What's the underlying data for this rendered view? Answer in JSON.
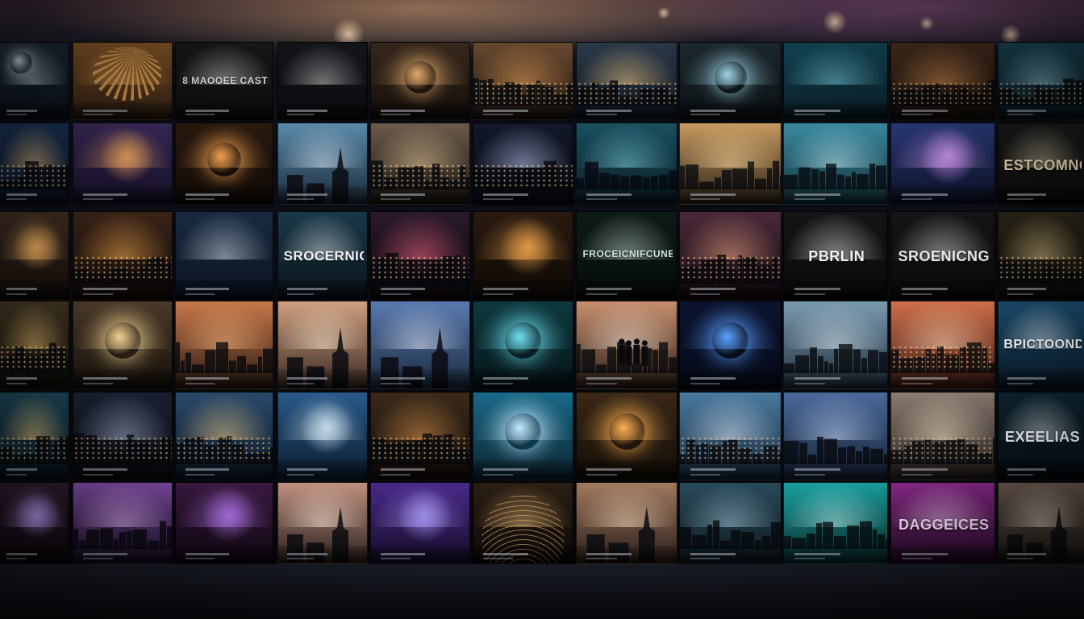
{
  "scene": {
    "description_colors": {
      "warm": "#e8a35a",
      "teal": "#2aa6b8",
      "purple": "#7a3fb0",
      "night": "#0e1422"
    }
  },
  "tiles": [
    {
      "theme": "moon",
      "palette": [
        "#1d2a3a",
        "#0c111a"
      ],
      "accent": "#cfd8e6",
      "caption": ""
    },
    {
      "theme": "rays",
      "palette": [
        "#8a5a2a",
        "#2a1a10"
      ],
      "accent": "#f4b15c",
      "caption": ""
    },
    {
      "theme": "title",
      "palette": [
        "#1a1a1a",
        "#0d0d0d"
      ],
      "accent": "#e6e6e6",
      "caption": "8 MAOOEE CAST"
    },
    {
      "theme": "title",
      "palette": [
        "#15161b",
        "#0b0b0f"
      ],
      "accent": "#c9c9c9",
      "caption": ""
    },
    {
      "theme": "orb",
      "palette": [
        "#3a2a1e",
        "#110c09"
      ],
      "accent": "#e0a86a",
      "caption": ""
    },
    {
      "theme": "city",
      "palette": [
        "#6a4a30",
        "#1a1410"
      ],
      "accent": "#f2a65a",
      "caption": ""
    },
    {
      "theme": "city",
      "palette": [
        "#2c3a4a",
        "#0e141c"
      ],
      "accent": "#ffd38c",
      "caption": ""
    },
    {
      "theme": "orb",
      "palette": [
        "#1e2a30",
        "#0a0f12"
      ],
      "accent": "#9fd4e8",
      "caption": ""
    },
    {
      "theme": "title",
      "palette": [
        "#134a5a",
        "#0a1a22"
      ],
      "accent": "#7ed6e8",
      "caption": ""
    },
    {
      "theme": "city",
      "palette": [
        "#4a3020",
        "#140e0a"
      ],
      "accent": "#f2a25a",
      "caption": ""
    },
    {
      "theme": "city",
      "palette": [
        "#1e4a5a",
        "#0a1820"
      ],
      "accent": "#9fe0ee",
      "caption": ""
    },
    {
      "theme": "city",
      "palette": [
        "#1a3050",
        "#0a1220"
      ],
      "accent": "#ffcf80",
      "caption": ""
    },
    {
      "theme": "galaxy",
      "palette": [
        "#3a2a5a",
        "#140e24"
      ],
      "accent": "#ffb060",
      "caption": ""
    },
    {
      "theme": "orb",
      "palette": [
        "#2a1a10",
        "#0e0906"
      ],
      "accent": "#f0a050",
      "caption": ""
    },
    {
      "theme": "spires",
      "palette": [
        "#5a8aaa",
        "#1a2a3a"
      ],
      "accent": "#e0eef8",
      "caption": ""
    },
    {
      "theme": "city",
      "palette": [
        "#6a5a4a",
        "#1a1612"
      ],
      "accent": "#f0d0a0",
      "caption": ""
    },
    {
      "theme": "city",
      "palette": [
        "#12182a",
        "#07090f"
      ],
      "accent": "#c8d2ff",
      "caption": ""
    },
    {
      "theme": "fog",
      "palette": [
        "#1a5060",
        "#0a1c24"
      ],
      "accent": "#7fd2e2",
      "caption": ""
    },
    {
      "theme": "sunset",
      "palette": [
        "#c89a60",
        "#2a2218"
      ],
      "accent": "#ffdca0",
      "caption": ""
    },
    {
      "theme": "fog",
      "palette": [
        "#3a8aa0",
        "#12303a"
      ],
      "accent": "#c8f0fa",
      "caption": ""
    },
    {
      "theme": "galaxy",
      "palette": [
        "#2a3a7a",
        "#0c1024"
      ],
      "accent": "#e0a0ff",
      "caption": ""
    },
    {
      "theme": "title",
      "palette": [
        "#1a1a1a",
        "#0b0b0b"
      ],
      "accent": "#e6d6b0",
      "caption": "ESTCOMNO"
    },
    {
      "theme": "galaxy",
      "palette": [
        "#3a2a20",
        "#120c08"
      ],
      "accent": "#f0b060",
      "caption": ""
    },
    {
      "theme": "city",
      "palette": [
        "#3a2418",
        "#120a06"
      ],
      "accent": "#ffb050",
      "caption": ""
    },
    {
      "theme": "title",
      "palette": [
        "#1a2a40",
        "#0a1220"
      ],
      "accent": "#d6e2f2",
      "caption": ""
    },
    {
      "theme": "title",
      "palette": [
        "#1a3848",
        "#0a141c"
      ],
      "accent": "#eef4fa",
      "caption": "SROCERNIC"
    },
    {
      "theme": "city",
      "palette": [
        "#2a1a2a",
        "#0e080e"
      ],
      "accent": "#ff6a8a",
      "caption": ""
    },
    {
      "theme": "burst",
      "palette": [
        "#2a1a10",
        "#0e0906"
      ],
      "accent": "#ffb050",
      "caption": ""
    },
    {
      "theme": "title",
      "palette": [
        "#0e1a16",
        "#060c0a"
      ],
      "accent": "#cfe6dc",
      "caption": "FROCEICNIFCUNE"
    },
    {
      "theme": "city",
      "palette": [
        "#4a2a3a",
        "#140a10"
      ],
      "accent": "#ffb08a",
      "caption": ""
    },
    {
      "theme": "title",
      "palette": [
        "#141414",
        "#0a0a0a"
      ],
      "accent": "#f2f2f2",
      "caption": "PBRLIN"
    },
    {
      "theme": "title",
      "palette": [
        "#151515",
        "#0a0a0a"
      ],
      "accent": "#e6e6e6",
      "caption": "SROENICNG"
    },
    {
      "theme": "city",
      "palette": [
        "#2a2418",
        "#0e0c08"
      ],
      "accent": "#e8d090",
      "caption": ""
    },
    {
      "theme": "city",
      "palette": [
        "#3a3020",
        "#120e08"
      ],
      "accent": "#f0c070",
      "caption": ""
    },
    {
      "theme": "orb",
      "palette": [
        "#4a3a2a",
        "#16100a"
      ],
      "accent": "#f0d090",
      "caption": ""
    },
    {
      "theme": "sunset",
      "palette": [
        "#c8784a",
        "#2a1a14"
      ],
      "accent": "#ffc080",
      "caption": ""
    },
    {
      "theme": "spires",
      "palette": [
        "#d0a080",
        "#3a2a22"
      ],
      "accent": "#fff0d8",
      "caption": ""
    },
    {
      "theme": "spires",
      "palette": [
        "#5a7ab0",
        "#1a2a40"
      ],
      "accent": "#e8eeff",
      "caption": ""
    },
    {
      "theme": "orb",
      "palette": [
        "#0e3a40",
        "#061418"
      ],
      "accent": "#6ee0f0",
      "caption": ""
    },
    {
      "theme": "people",
      "palette": [
        "#c89070",
        "#2a2018"
      ],
      "accent": "#fff0e0",
      "caption": ""
    },
    {
      "theme": "orb",
      "palette": [
        "#0c1430",
        "#060a18"
      ],
      "accent": "#5aa0ff",
      "caption": ""
    },
    {
      "theme": "fog",
      "palette": [
        "#7a9ab0",
        "#22303c"
      ],
      "accent": "#e0eef8",
      "caption": ""
    },
    {
      "theme": "city",
      "palette": [
        "#d0704a",
        "#3a1a12"
      ],
      "accent": "#ffe0c0",
      "caption": ""
    },
    {
      "theme": "title",
      "palette": [
        "#1a4a6a",
        "#0a1a28"
      ],
      "accent": "#f2f8ff",
      "caption": "BPICTOOND"
    },
    {
      "theme": "city",
      "palette": [
        "#1a4050",
        "#0a1820"
      ],
      "accent": "#ffd080",
      "caption": ""
    },
    {
      "theme": "city",
      "palette": [
        "#1a2030",
        "#0a0c12"
      ],
      "accent": "#b0c0e0",
      "caption": ""
    },
    {
      "theme": "city",
      "palette": [
        "#2a4a6a",
        "#0c1624"
      ],
      "accent": "#ffd890",
      "caption": ""
    },
    {
      "theme": "burst",
      "palette": [
        "#2a5a8a",
        "#0a1c2e"
      ],
      "accent": "#e0f4ff",
      "caption": ""
    },
    {
      "theme": "city",
      "palette": [
        "#3a2a1a",
        "#120c08"
      ],
      "accent": "#f0a050",
      "caption": ""
    },
    {
      "theme": "orb",
      "palette": [
        "#1a6a8a",
        "#0a2430"
      ],
      "accent": "#c0e8ff",
      "caption": ""
    },
    {
      "theme": "orb",
      "palette": [
        "#3a2818",
        "#120c06"
      ],
      "accent": "#ffb050",
      "caption": ""
    },
    {
      "theme": "city",
      "palette": [
        "#4a7aa0",
        "#16283a"
      ],
      "accent": "#e8f0ff",
      "caption": ""
    },
    {
      "theme": "fog",
      "palette": [
        "#4a6a9a",
        "#162238"
      ],
      "accent": "#c8dcff",
      "caption": ""
    },
    {
      "theme": "city",
      "palette": [
        "#8a7a70",
        "#2a2420"
      ],
      "accent": "#fff0d0",
      "caption": ""
    },
    {
      "theme": "title",
      "palette": [
        "#0e2430",
        "#060e14"
      ],
      "accent": "#f2f8ff",
      "caption": "EXEELIAS"
    },
    {
      "theme": "galaxy",
      "palette": [
        "#2a1a2a",
        "#0e080e"
      ],
      "accent": "#c0a0ff",
      "caption": ""
    },
    {
      "theme": "sunset",
      "palette": [
        "#7a4aa0",
        "#1e1228"
      ],
      "accent": "#f0c0ff",
      "caption": ""
    },
    {
      "theme": "galaxy",
      "palette": [
        "#3a1a40",
        "#120814"
      ],
      "accent": "#c080ff",
      "caption": ""
    },
    {
      "theme": "spires",
      "palette": [
        "#c09080",
        "#2e2420"
      ],
      "accent": "#fff0e0",
      "caption": ""
    },
    {
      "theme": "galaxy",
      "palette": [
        "#4a2a8a",
        "#140c28"
      ],
      "accent": "#b0a0ff",
      "caption": ""
    },
    {
      "theme": "arcs",
      "palette": [
        "#2a1e14",
        "#0c0806"
      ],
      "accent": "#e0b070",
      "caption": ""
    },
    {
      "theme": "spires",
      "palette": [
        "#a07a60",
        "#2a1e18"
      ],
      "accent": "#ffe0c0",
      "caption": ""
    },
    {
      "theme": "fog",
      "palette": [
        "#2a4a5a",
        "#0e1a20"
      ],
      "accent": "#a0c8d8",
      "caption": ""
    },
    {
      "theme": "fog",
      "palette": [
        "#1aa0a0",
        "#0a3030"
      ],
      "accent": "#d0fffa",
      "caption": ""
    },
    {
      "theme": "title",
      "palette": [
        "#8a2a8a",
        "#240a24"
      ],
      "accent": "#ffe0ff",
      "caption": "DAGGEICES"
    },
    {
      "theme": "spires",
      "palette": [
        "#6a5a50",
        "#1a1612"
      ],
      "accent": "#f0e0d0",
      "caption": ""
    }
  ]
}
